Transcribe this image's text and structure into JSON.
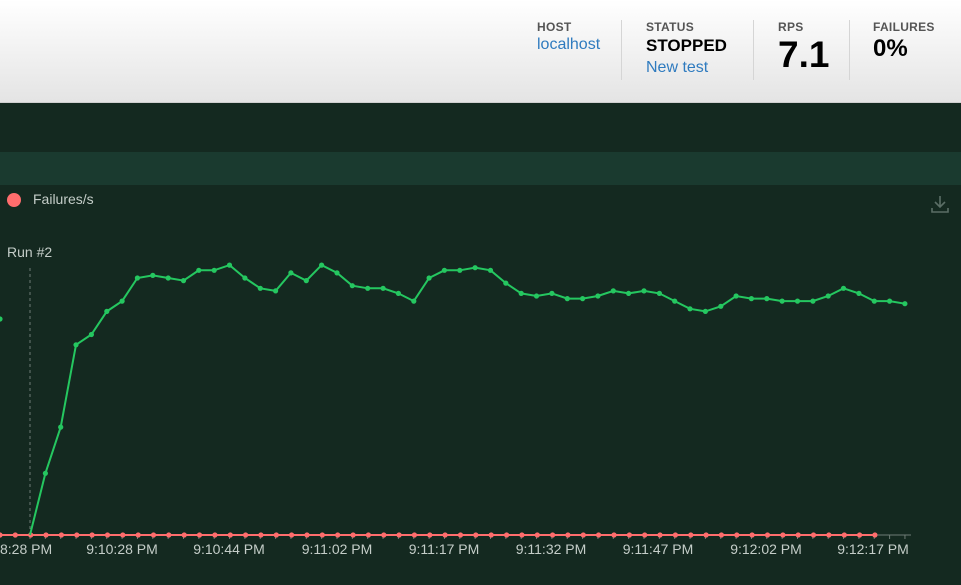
{
  "header": {
    "host": {
      "label": "HOST",
      "value": "localhost"
    },
    "status": {
      "label": "STATUS",
      "value": "STOPPED",
      "link": "New test"
    },
    "rps": {
      "label": "RPS",
      "value": "7.1"
    },
    "failures": {
      "label": "FAILURES",
      "value": "0%"
    }
  },
  "colors": {
    "rps_line": "#25c760",
    "failures_line": "#ff6d6d",
    "link": "#2f7bbf",
    "panel_bg": "#142920"
  },
  "chart_data": {
    "type": "line",
    "legend": [
      "Failures/s"
    ],
    "legend_placement": "top-left",
    "annotation": "Run #2",
    "x_tick_labels": [
      "9:10:28 PM",
      "9:10:44 PM",
      "9:11:02 PM",
      "9:11:17 PM",
      "9:11:32 PM",
      "9:11:47 PM",
      "9:12:02 PM",
      "9:12:17 PM"
    ],
    "first_tick_partial": "8:28 PM",
    "ylim": [
      0,
      100
    ],
    "grid": false,
    "series": [
      {
        "color": "#25c760",
        "values": [
          24,
          42,
          74,
          78,
          87,
          91,
          100,
          101,
          100,
          99,
          103,
          103,
          105,
          100,
          96,
          95,
          102,
          99,
          105,
          102,
          97,
          96,
          96,
          94,
          91,
          100,
          103,
          103,
          104,
          103,
          98,
          94,
          93,
          94,
          92,
          92,
          93,
          95,
          94,
          95,
          94,
          91,
          88,
          87,
          89,
          93,
          92,
          92,
          91,
          91,
          91,
          93,
          96,
          94,
          91,
          91,
          90
        ]
      },
      {
        "name": "Failures/s",
        "color": "#ff6d6d",
        "values": [
          0,
          0,
          0,
          0,
          0,
          0,
          0,
          0,
          0,
          0,
          0,
          0,
          0,
          0,
          0,
          0,
          0,
          0,
          0,
          0,
          0,
          0,
          0,
          0,
          0,
          0,
          0,
          0,
          0,
          0,
          0,
          0,
          0,
          0,
          0,
          0,
          0,
          0,
          0,
          0,
          0,
          0,
          0,
          0,
          0,
          0,
          0,
          0,
          0,
          0,
          0,
          0,
          0,
          0,
          0,
          0,
          0,
          0,
          0
        ]
      }
    ]
  }
}
